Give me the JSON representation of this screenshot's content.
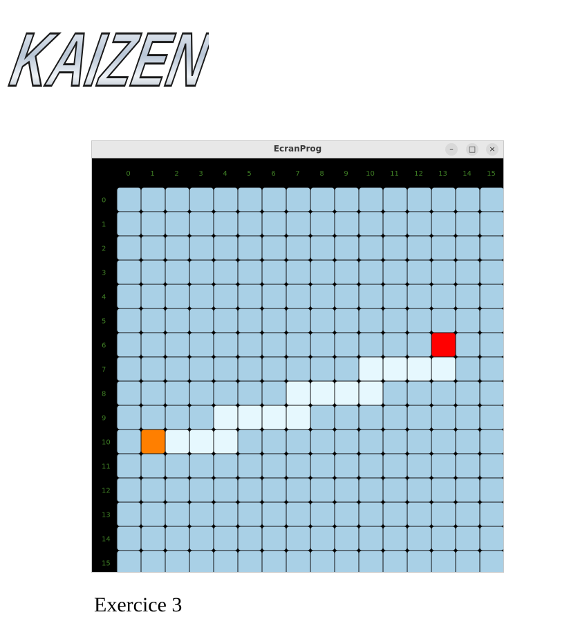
{
  "logo": {
    "text": "KAIZEN",
    "icon": "kaizen-logo"
  },
  "window": {
    "title": "EcranProg",
    "controls": {
      "minimize": "–",
      "maximize": "□",
      "close": "×"
    }
  },
  "grid": {
    "columns": [
      "0",
      "1",
      "2",
      "3",
      "4",
      "5",
      "6",
      "7",
      "8",
      "9",
      "10",
      "11",
      "12",
      "13",
      "14",
      "15"
    ],
    "rows": [
      "0",
      "1",
      "2",
      "3",
      "4",
      "5",
      "6",
      "7",
      "8",
      "9",
      "10",
      "11",
      "12",
      "13",
      "14",
      "15"
    ],
    "colors": {
      "empty": "#a9d0e6",
      "path": "#e6f8fe",
      "start": "#ff7f00",
      "target": "#ff0000",
      "label": "#3f7f25",
      "background": "#000000"
    },
    "start": {
      "row": 10,
      "col": 1
    },
    "target": {
      "row": 6,
      "col": 13
    },
    "path": [
      {
        "row": 10,
        "col": 2
      },
      {
        "row": 10,
        "col": 3
      },
      {
        "row": 10,
        "col": 4
      },
      {
        "row": 9,
        "col": 4
      },
      {
        "row": 9,
        "col": 5
      },
      {
        "row": 9,
        "col": 6
      },
      {
        "row": 9,
        "col": 7
      },
      {
        "row": 8,
        "col": 7
      },
      {
        "row": 8,
        "col": 8
      },
      {
        "row": 8,
        "col": 9
      },
      {
        "row": 8,
        "col": 10
      },
      {
        "row": 7,
        "col": 10
      },
      {
        "row": 7,
        "col": 11
      },
      {
        "row": 7,
        "col": 12
      },
      {
        "row": 7,
        "col": 13
      }
    ]
  },
  "caption": "Exercice 3"
}
